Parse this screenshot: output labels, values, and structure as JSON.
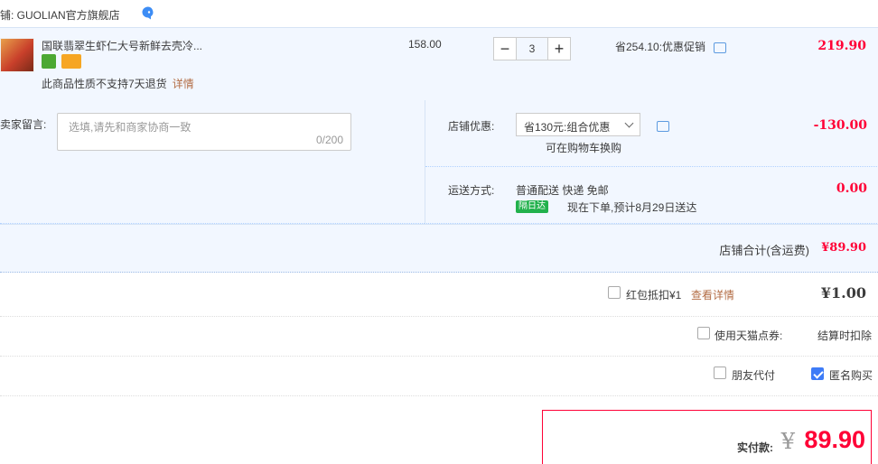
{
  "store": {
    "label": "店铺: GUOLIAN官方旗舰店"
  },
  "item": {
    "title": "国联翡翠生虾仁大号新鲜去壳冷...",
    "no_return": "此商品性质不支持7天退货",
    "detail_link": "详情",
    "unit_price": "158.00",
    "qty_minus": "−",
    "qty": "3",
    "qty_plus": "+",
    "promo": "省254.10:优惠促销",
    "total": "219.90"
  },
  "message": {
    "label": "给卖家留言:",
    "placeholder": "选填,请先和商家协商一致",
    "counter": "0/200"
  },
  "shop_discount": {
    "label": "店铺优惠:",
    "selected": "省130元:组合优惠",
    "note": "可在购物车换购",
    "amount": "-130.00"
  },
  "shipping": {
    "label": "运送方式:",
    "method": "普通配送 快递 免邮",
    "badge": "隔日达",
    "eta": "现在下单,预计8月29日送达",
    "amount": "0.00"
  },
  "store_total": {
    "label": "店铺合计(含运费)",
    "amount": "¥89.90"
  },
  "red_packet": {
    "label": "红包抵扣¥1",
    "link": "查看详情",
    "amount": "¥1.00",
    "checked": false
  },
  "tmall_points": {
    "label": "使用天猫点券:",
    "status": "结算时扣除",
    "checked": false
  },
  "options": {
    "friend_pay": {
      "label": "朋友代付",
      "checked": false
    },
    "anonymous": {
      "label": "匿名购买",
      "checked": true
    }
  },
  "pay": {
    "label": "实付款:",
    "currency": "¥",
    "amount": "89.90"
  },
  "colors": {
    "price_red": "#ff0036",
    "link_brown": "#b36d45",
    "panel_blue": "#f2f7ff",
    "accent_blue": "#3e7cf7"
  }
}
